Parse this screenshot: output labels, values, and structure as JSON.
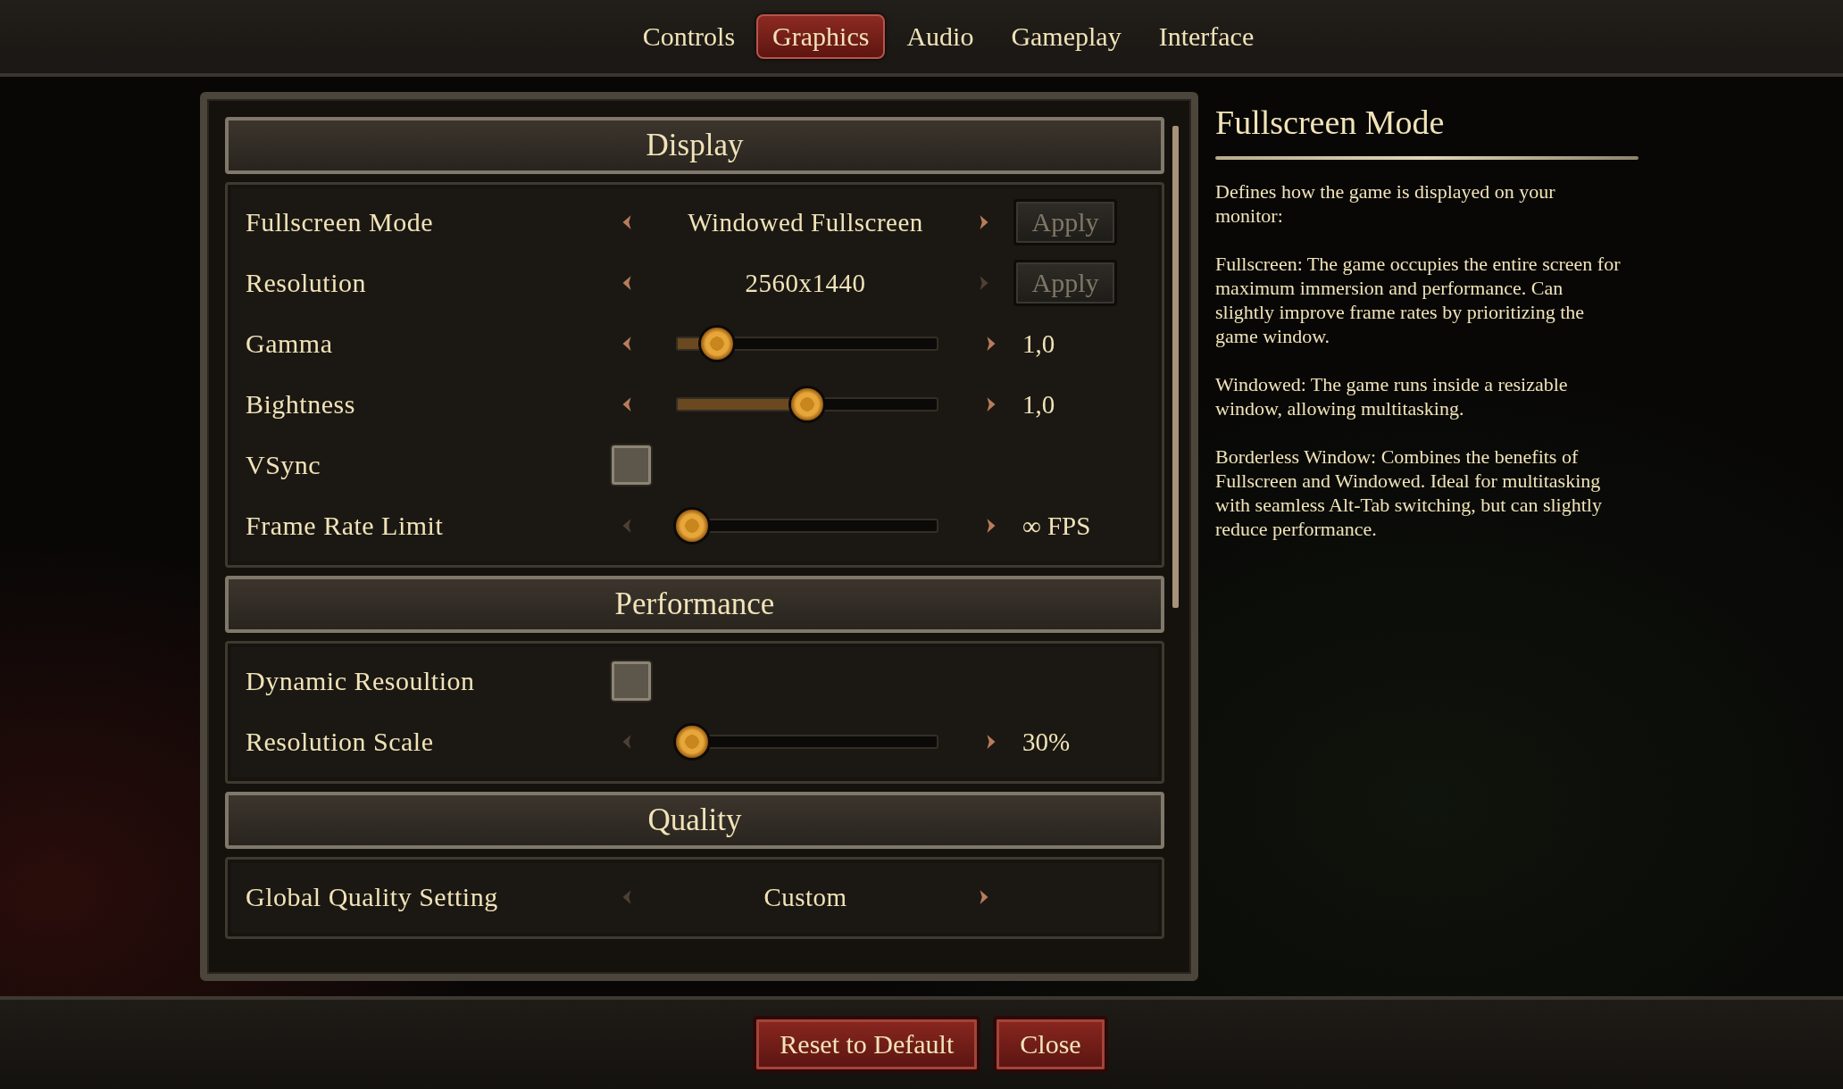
{
  "tabs": [
    {
      "label": "Controls",
      "selected": false
    },
    {
      "label": "Graphics",
      "selected": true
    },
    {
      "label": "Audio",
      "selected": false
    },
    {
      "label": "Gameplay",
      "selected": false
    },
    {
      "label": "Interface",
      "selected": false
    }
  ],
  "sections": [
    {
      "title": "Display",
      "rows": [
        {
          "kind": "select",
          "label": "Fullscreen Mode",
          "value": "Windowed Fullscreen",
          "prev_enabled": true,
          "next_enabled": true,
          "apply": "Apply"
        },
        {
          "kind": "select",
          "label": "Resolution",
          "value": "2560x1440",
          "prev_enabled": true,
          "next_enabled": false,
          "apply": "Apply"
        },
        {
          "kind": "slider",
          "label": "Gamma",
          "level": 0.11,
          "value": "1,0",
          "prev_enabled": true,
          "next_enabled": true
        },
        {
          "kind": "slider",
          "label": "Bightness",
          "level": 0.5,
          "value": "1,0",
          "prev_enabled": true,
          "next_enabled": true
        },
        {
          "kind": "checkbox",
          "label": "VSync",
          "checked": false
        },
        {
          "kind": "slider",
          "label": "Frame Rate Limit",
          "level": 0,
          "value": "∞ FPS",
          "prev_enabled": false,
          "next_enabled": true
        }
      ]
    },
    {
      "title": "Performance",
      "rows": [
        {
          "kind": "checkbox",
          "label": "Dynamic Resoultion",
          "checked": false
        },
        {
          "kind": "slider",
          "label": "Resolution Scale",
          "level": 0,
          "value": "30%",
          "prev_enabled": false,
          "next_enabled": true
        }
      ]
    },
    {
      "title": "Quality",
      "rows": [
        {
          "kind": "select",
          "label": "Global Quality Setting",
          "value": "Custom",
          "prev_enabled": false,
          "next_enabled": true
        }
      ]
    }
  ],
  "help": {
    "title": "Fullscreen Mode",
    "paragraphs": [
      "Defines how the game is displayed on your monitor:",
      "Fullscreen: The game occupies the entire screen for maximum immersion and performance. Can slightly improve frame rates by prioritizing the game window.",
      "Windowed: The game runs inside a resizable window, allowing multitasking.",
      "Borderless Window: Combines the benefits of Fullscreen and Windowed. Ideal for multitasking with seamless Alt-Tab switching, but can slightly reduce performance."
    ]
  },
  "buttons": [
    "Reset to Default",
    "Close"
  ]
}
